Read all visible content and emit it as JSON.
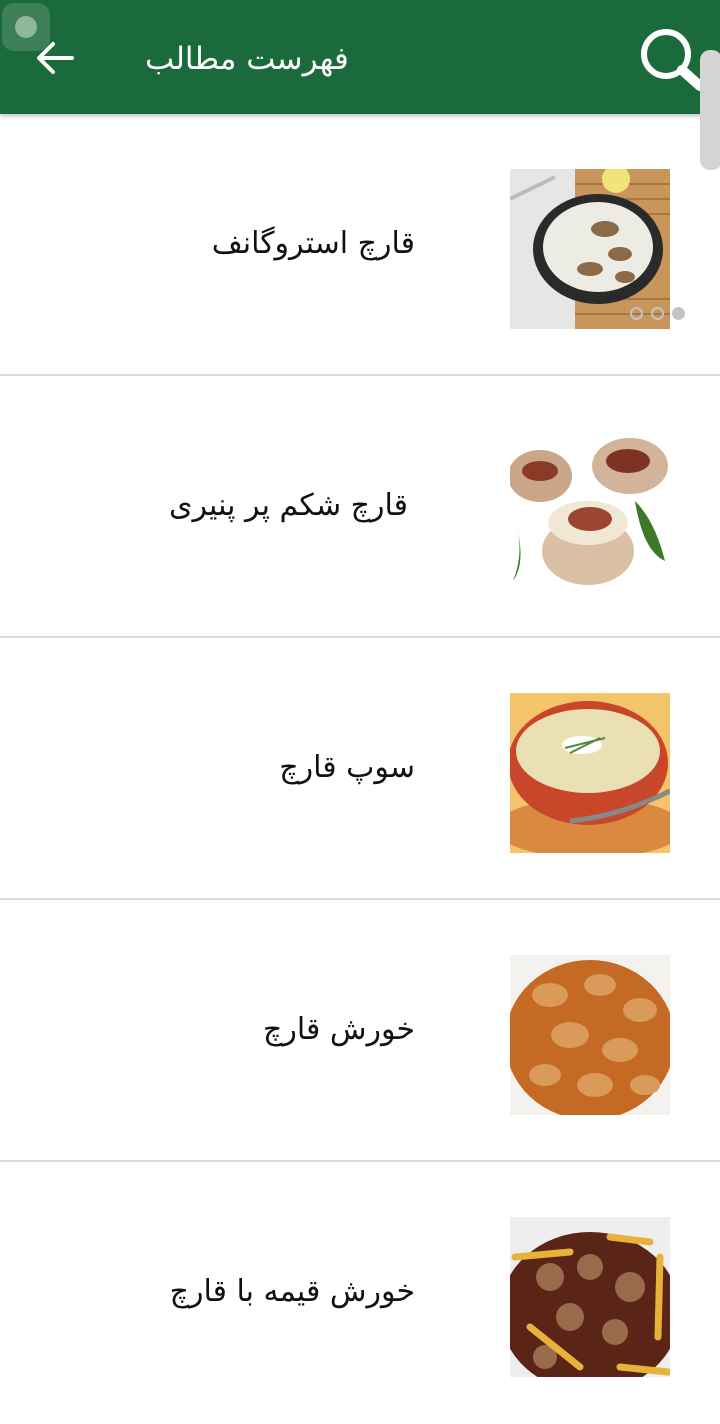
{
  "appbar": {
    "title": "فهرست مطالب",
    "back_icon": "arrow-left-icon",
    "search_icon": "search-icon",
    "color": "#1b6a3c"
  },
  "items": [
    {
      "label": "قارچ استروگانف",
      "image": "mushroom-stroganoff-photo"
    },
    {
      "label": "قارچ شکم پر پنیری",
      "image": "stuffed-mushroom-photo"
    },
    {
      "label": "سوپ قارچ",
      "image": "mushroom-soup-photo"
    },
    {
      "label": "خورش قارچ",
      "image": "mushroom-stew-photo"
    },
    {
      "label": "خورش قیمه با قارچ",
      "image": "gheymeh-stew-photo"
    }
  ]
}
